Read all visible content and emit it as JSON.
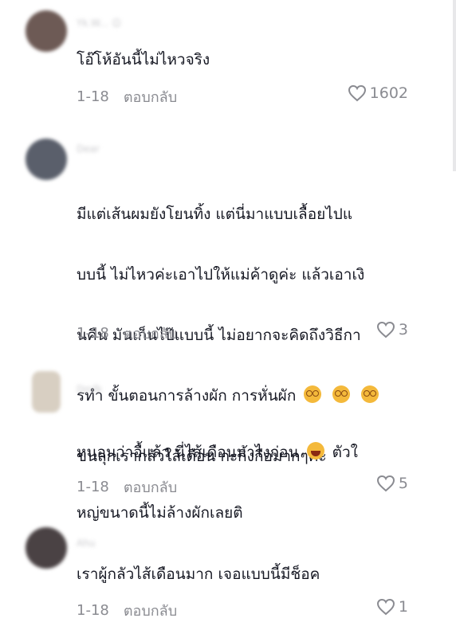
{
  "comments": [
    {
      "username": "Yk.W... ☺",
      "text": "โอ๊โห้อันนี้ไม่ไหวจริง",
      "date": "1-18",
      "reply_label": "ตอบกลับ",
      "likes": "1602",
      "avatar_color": "#6d5a55"
    },
    {
      "username": "Dear",
      "text_lines": [
        "มีแต่เส้นผมยังโยนทิ้ง แต่นี่มาแบบเลื้อยไปแ",
        "บบนี้ ไม่ไหวค่ะเอาไปให้แม่ค้าดูค่ะ แล้วเอาเงิ",
        "นคืน มันเก็นไป๊แบบนี้ ไม่อยากจะคิดถึงวิธีกา",
        "รทำ ขั้นตอนการล้างผัก การหั่นผัก",
        "ขนลุกเรากลัวใส้เดือน กะกิ้งกือมากๆค่ะ"
      ],
      "date": "1-18",
      "reply_label": "ตอบกลับ",
      "likes": "3",
      "avatar_color": "#5a5f6b"
    },
    {
      "username": "Dmfk",
      "text_lines": [
        "หนอนว่าอื้แล้ว นี่ไส้เดือนมาไงก่อน",
        "หญ่ขนาดนี้ไม่ล้างผักเลยติ"
      ],
      "line1_suffix": "ตัวใ",
      "date": "1-18",
      "reply_label": "ตอบกลับ",
      "likes": "5",
      "avatar_color": "#d8cfc2"
    },
    {
      "username": "Ahu",
      "text": "เราผู้กลัวไส้เดือนมาก เจอแบบนี้มีช็อค",
      "date": "1-18",
      "reply_label": "ตอบกลับ",
      "likes": "1",
      "avatar_color": "#4a4244"
    }
  ],
  "icons": {
    "like": "heart-outline-icon",
    "dizzy": "dizzy-face-emoji",
    "laugh": "laughing-face-emoji"
  }
}
